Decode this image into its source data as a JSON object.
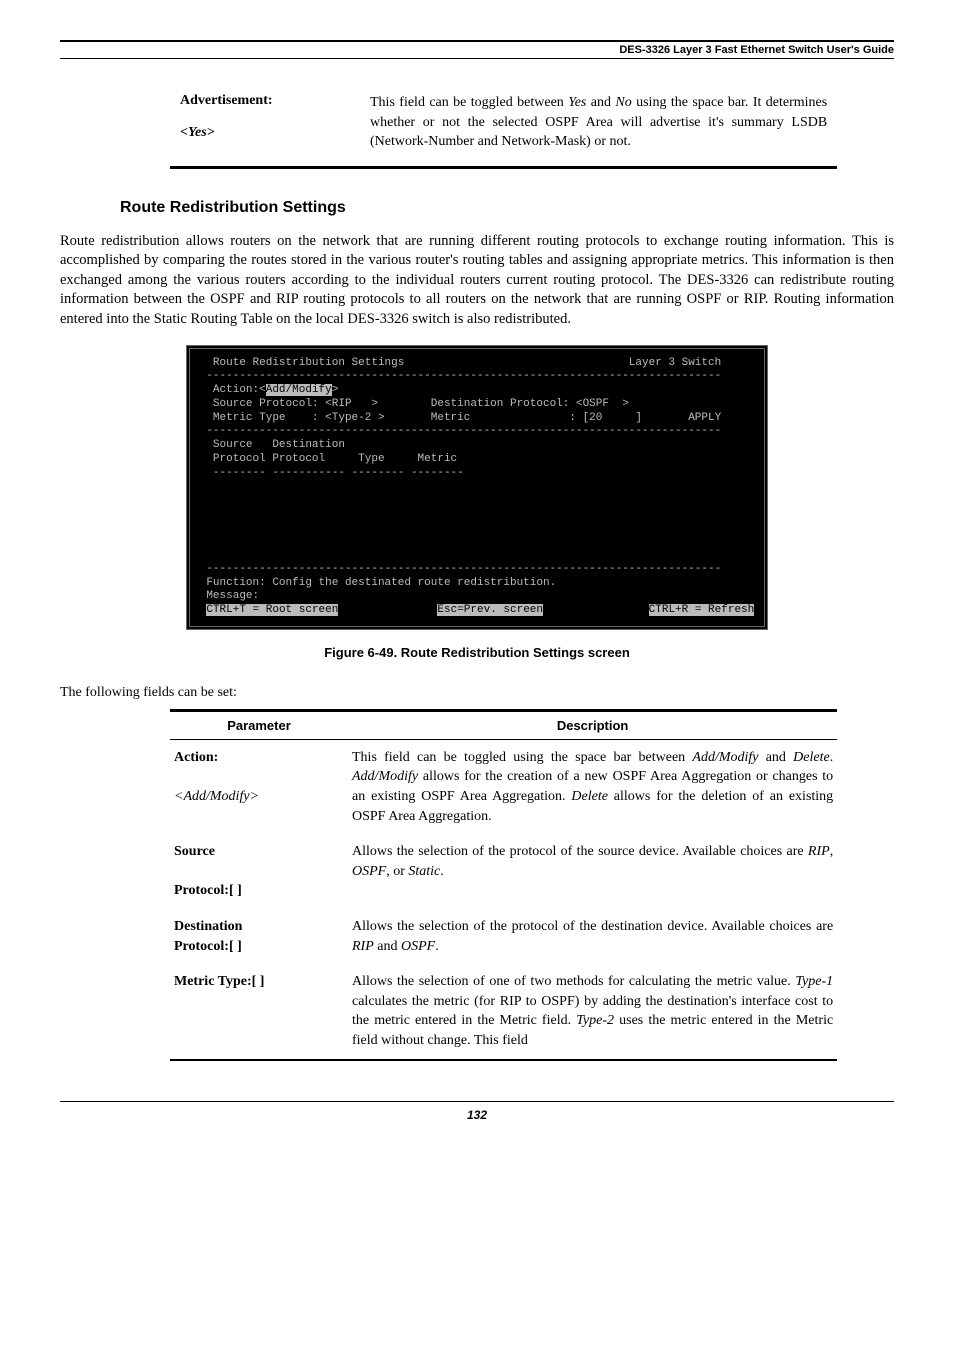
{
  "header": {
    "title": "DES-3326 Layer 3 Fast Ethernet Switch User's Guide"
  },
  "adv_table": {
    "label_bold": "Advertisement:",
    "label_ital": "<Yes>",
    "desc": "This field can be toggled between Yes and No using the space bar. It determines whether or not the selected OSPF Area will advertise it's summary LSDB (Network-Number and Network-Mask) or not."
  },
  "section": {
    "heading": "Route Redistribution Settings",
    "para": "Route redistribution allows routers on the network that are running different routing protocols to exchange routing information. This is accomplished by comparing the routes stored in the various router's routing tables and assigning appropriate metrics. This information is then exchanged among the various routers according to the individual routers current routing protocol. The DES-3326 can redistribute routing information between the OSPF and RIP routing protocols to all routers on the network that are running OSPF or RIP. Routing information entered into the Static Routing Table on the local DES-3326 switch is also redistributed."
  },
  "terminal": {
    "line1": "  Route Redistribution Settings                                  Layer 3 Switch",
    "dashA": " ------------------------------------------------------------------------------",
    "line2a": "  Action:<",
    "line2hl": "Add/Modify",
    "line2b": ">",
    "line3": "  Source Protocol: <RIP   >        Destination Protocol: <OSPF  >",
    "line4": "  Metric Type    : <Type-2 >       Metric               : [20     ]       APPLY",
    "dashB": " ------------------------------------------------------------------------------",
    "line5": "  Source   Destination",
    "line6": "  Protocol Protocol     Type     Metric",
    "line7": "  -------- ----------- -------- --------",
    "blank": " ",
    "dashC": " ------------------------------------------------------------------------------",
    "line8": " Function: Config the destinated route redistribution.",
    "line9": " Message:",
    "foot_a": "CTRL+T = Root screen",
    "foot_b": "Esc=Prev. screen",
    "foot_c": "CTRL+R = Refresh"
  },
  "figure_caption": "Figure 6-49.  Route Redistribution Settings screen",
  "fields_intro": "The following fields can be set:",
  "columns": {
    "param": "Parameter",
    "desc": "Description"
  },
  "rows": {
    "action": {
      "label_bold": "Action:",
      "label_ital": "<Add/Modify>",
      "desc_a": "This field can be toggled using the space bar between ",
      "desc_b": "Add/Modify",
      "desc_c": " and ",
      "desc_d": "Delete",
      "desc_e": ". ",
      "desc_f": "Add/Modify",
      "desc_g": " allows for the creation of a new OSPF Area Aggregation or changes to an existing OSPF Area Aggregation. ",
      "desc_h": "Delete",
      "desc_i": " allows for the deletion of an existing OSPF Area Aggregation."
    },
    "source": {
      "label_bold": "Source",
      "label_bold2": "Protocol:[    ]",
      "desc_a": "Allows the selection of the protocol of the source device. Available choices are ",
      "desc_b": "RIP",
      "desc_c": ", ",
      "desc_d": "OSPF",
      "desc_e": ", or ",
      "desc_f": "Static",
      "desc_g": "."
    },
    "dest": {
      "label_bold": "Destination",
      "label_bold2": "Protocol:[         ]",
      "desc_a": "Allows the selection of the protocol of the destination device. Available choices are ",
      "desc_b": "RIP",
      "desc_c": " and ",
      "desc_d": "OSPF",
      "desc_e": "."
    },
    "metric": {
      "label_bold": "Metric Type:[    ]",
      "desc_a": "Allows the selection of one of two methods for calculating the metric value. ",
      "desc_b": "Type-1",
      "desc_c": " calculates the metric (for RIP to OSPF) by adding the destination's interface cost to the metric entered in the Metric field.  ",
      "desc_d": "Type-2",
      "desc_e": " uses the metric entered in the Metric field without change. This field"
    }
  },
  "footer": {
    "page": "132"
  }
}
